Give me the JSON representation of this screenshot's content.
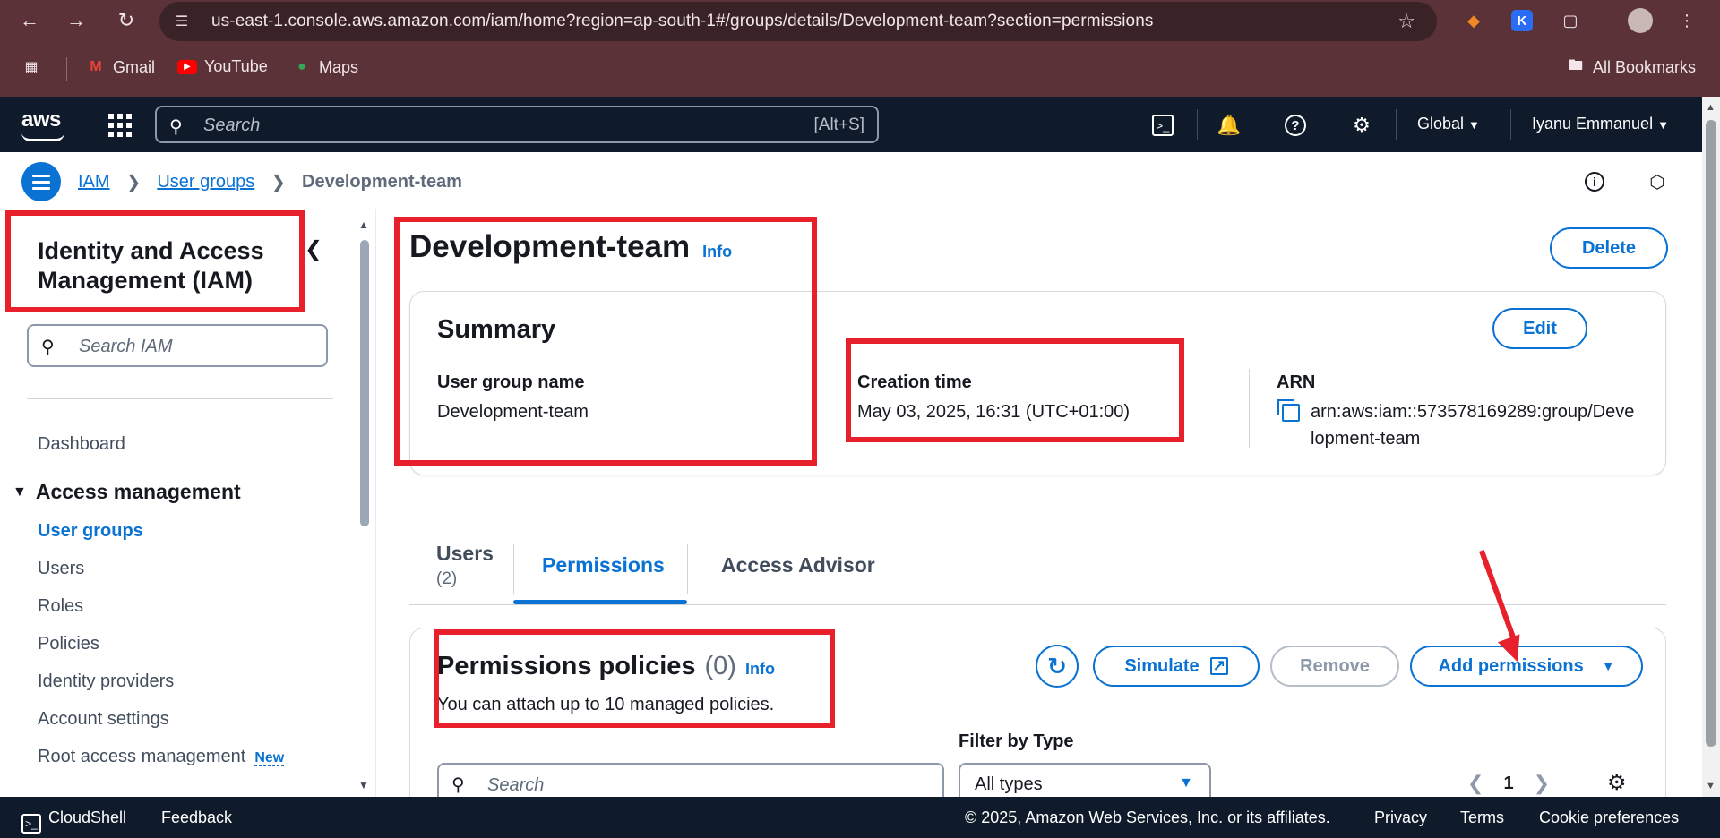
{
  "browser": {
    "url": "us-east-1.console.aws.amazon.com/iam/home?region=ap-south-1#/groups/details/Development-team?section=permissions",
    "bookmarks": [
      "Gmail",
      "YouTube",
      "Maps"
    ],
    "all_bookmarks": "All Bookmarks"
  },
  "awsnav": {
    "search_placeholder": "Search",
    "search_shortcut": "[Alt+S]",
    "region": "Global",
    "account": "Iyanu Emmanuel"
  },
  "breadcrumb": {
    "items": [
      "IAM",
      "User groups"
    ],
    "current": "Development-team"
  },
  "sidebar": {
    "title": "Identity and Access Management (IAM)",
    "search_placeholder": "Search IAM",
    "dashboard": "Dashboard",
    "section": "Access management",
    "items": [
      "User groups",
      "Users",
      "Roles",
      "Policies",
      "Identity providers",
      "Account settings",
      "Root access management"
    ],
    "new_badge": "New"
  },
  "page": {
    "title": "Development-team",
    "info": "Info",
    "delete": "Delete"
  },
  "summary": {
    "title": "Summary",
    "edit": "Edit",
    "group_name_label": "User group name",
    "group_name": "Development-team",
    "creation_label": "Creation time",
    "creation_time": "May 03, 2025, 16:31 (UTC+01:00)",
    "arn_label": "ARN",
    "arn": "arn:aws:iam::573578169289:group/Development-team"
  },
  "tabs": {
    "users": "Users",
    "users_count": "(2)",
    "permissions": "Permissions",
    "access_advisor": "Access Advisor"
  },
  "permissions": {
    "title": "Permissions policies",
    "count": "(0)",
    "info": "Info",
    "description": "You can attach up to 10 managed policies.",
    "simulate": "Simulate",
    "remove": "Remove",
    "add": "Add permissions",
    "filter_label": "Filter by Type",
    "search_placeholder": "Search",
    "filter_value": "All types",
    "page": "1"
  },
  "footer": {
    "cloudshell": "CloudShell",
    "feedback": "Feedback",
    "copyright": "© 2025, Amazon Web Services, Inc. or its affiliates.",
    "privacy": "Privacy",
    "terms": "Terms",
    "cookies": "Cookie preferences"
  },
  "colors": {
    "link": "#0972d3",
    "annotation": "#e8202b",
    "nav_bg": "#0f1b2a",
    "chrome_bg": "#5a3238"
  }
}
